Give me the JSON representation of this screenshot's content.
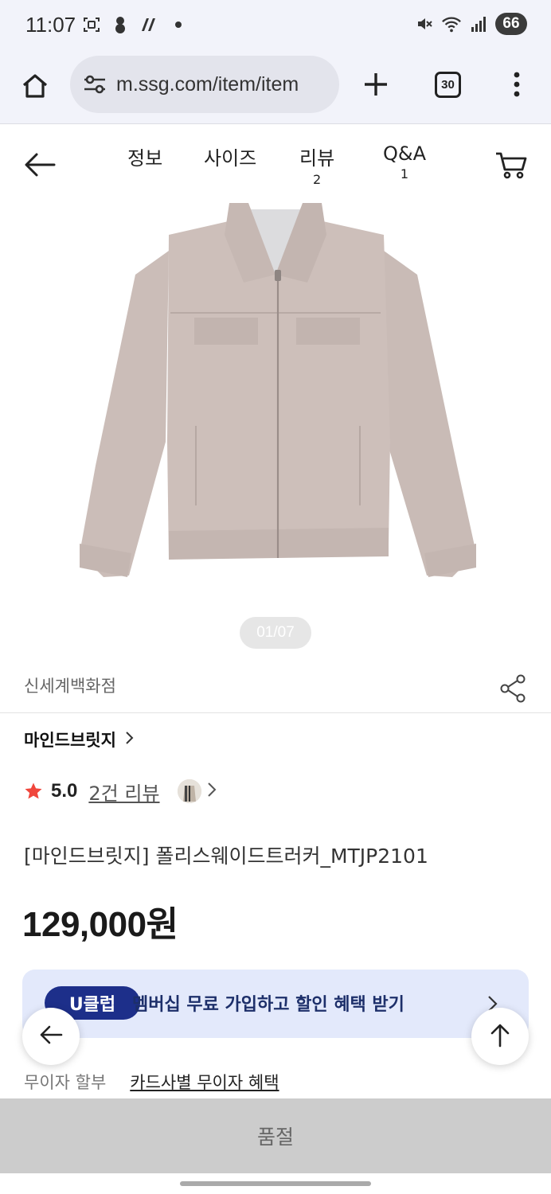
{
  "status_bar": {
    "time": "11:07",
    "battery": "66",
    "icons_left": [
      "screenshot-icon",
      "snowman-icon",
      "app-icon"
    ],
    "icons_right": [
      "mute-icon",
      "wifi-icon",
      "signal-icon"
    ]
  },
  "browser": {
    "url": "m.ssg.com/item/item",
    "tab_count": "30"
  },
  "header": {
    "tabs": [
      {
        "label": "정보",
        "count": ""
      },
      {
        "label": "사이즈",
        "count": ""
      },
      {
        "label": "리뷰",
        "count": "2"
      },
      {
        "label": "Q&A",
        "count": "1"
      }
    ]
  },
  "gallery": {
    "pager": "01/07"
  },
  "product": {
    "store": "신세계백화점",
    "brand": "마인드브릿지",
    "rating": "5.0",
    "review_link": "2건 리뷰",
    "title": "[마인드브릿지] 폴리스웨이드트러커_MTJP2101",
    "price": "129,000원"
  },
  "uclub": {
    "badge": "U클럽",
    "text": "멤버십 무료 가입하고 할인 혜택 받기"
  },
  "installment": {
    "label": "무이자 할부",
    "link": "카드사별 무이자 혜택"
  },
  "buy_bar": {
    "label": "품절"
  },
  "colors": {
    "accent_navy": "#1d2f8a",
    "uclub_bg": "#e3e9fb",
    "star_red": "#f0463c",
    "soldout_bg": "#cccccc"
  }
}
